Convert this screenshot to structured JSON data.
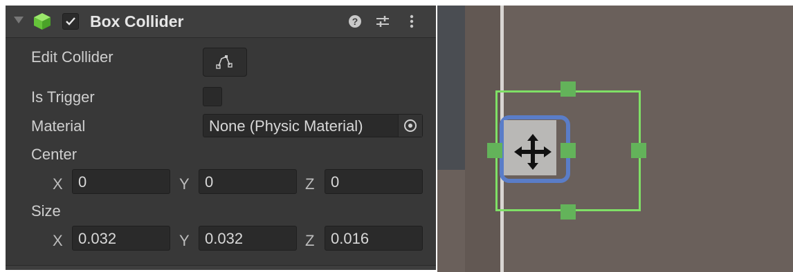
{
  "component": {
    "title": "Box Collider",
    "enabled": true,
    "icons": [
      "foldout-arrow-icon",
      "cube-icon",
      "checkmark-icon",
      "help-icon",
      "preset-sliders-icon",
      "kebab-menu-icon"
    ]
  },
  "fields": {
    "edit_collider_label": "Edit Collider",
    "is_trigger_label": "Is Trigger",
    "is_trigger_checked": false,
    "material_label": "Material",
    "material_value": "None (Physic Material)",
    "center_label": "Center",
    "size_label": "Size"
  },
  "center": {
    "x_label": "X",
    "x": "0",
    "y_label": "Y",
    "y": "0",
    "z_label": "Z",
    "z": "0"
  },
  "size": {
    "x_label": "X",
    "x": "0.032",
    "y_label": "Y",
    "y": "0.032",
    "z_label": "Z",
    "z": "0.016"
  },
  "scene": {
    "icons": [
      "move-cross-icon"
    ],
    "colors": {
      "collider_bounds": "#7fe066",
      "selection_outline": "#5a7dc8",
      "background": "#6a605b"
    }
  }
}
